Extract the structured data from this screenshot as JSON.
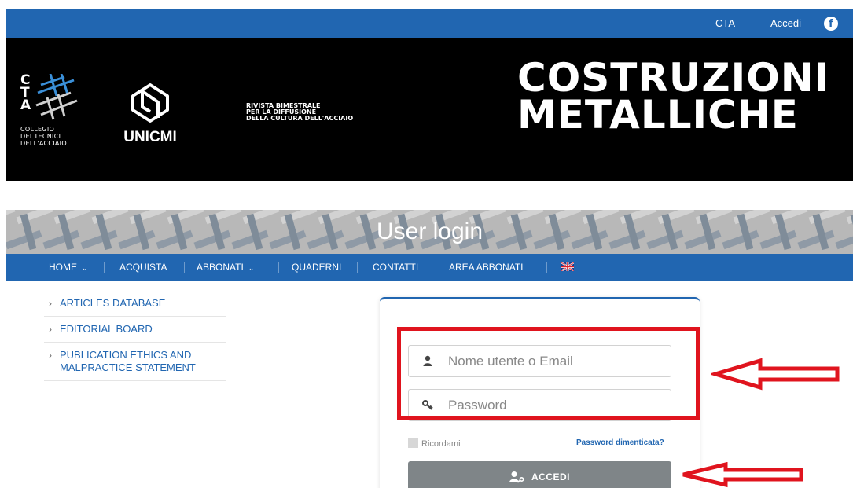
{
  "topbar": {
    "cta_label": "CTA",
    "accedi_label": "Accedi",
    "facebook_icon": "f"
  },
  "header": {
    "cta_logo": {
      "letters": [
        "C",
        "T",
        "A"
      ],
      "small_lines": [
        "COLLEGIO",
        "DEI TECNICI",
        "DELL'ACCIAIO"
      ]
    },
    "unicmi_logo": "UNICMI",
    "tagline": [
      "RIVISTA BIMESTRALE",
      "PER LA DIFFUSIONE",
      "DELLA CULTURA DELL'ACCIAIO"
    ],
    "magazine_title": [
      "COSTRUZIONI",
      "METALLICHE"
    ]
  },
  "banner": {
    "title": "User login"
  },
  "nav": {
    "items": [
      {
        "label": "HOME",
        "has_dropdown": true
      },
      {
        "label": "ACQUISTA",
        "has_dropdown": false
      },
      {
        "label": "ABBONATI",
        "has_dropdown": true
      },
      {
        "label": "QUADERNI",
        "has_dropdown": false
      },
      {
        "label": "CONTATTI",
        "has_dropdown": false
      },
      {
        "label": "AREA ABBONATI",
        "has_dropdown": false
      }
    ],
    "chevron": "⌄",
    "language_flag": "uk-flag-icon"
  },
  "sidebar": {
    "items": [
      {
        "label": "ARTICLES DATABASE"
      },
      {
        "label": "EDITORIAL BOARD"
      },
      {
        "label": "PUBLICATION ETHICS AND MALPRACTICE STATEMENT"
      }
    ],
    "arrow_glyph": "›"
  },
  "login": {
    "username_placeholder": "Nome utente o Email",
    "password_placeholder": "Password",
    "remember_label": "Ricordami",
    "forgot_label": "Password dimenticata?",
    "submit_label": "ACCEDI"
  },
  "colors": {
    "brand_blue": "#2166b1",
    "highlight_red": "#e0141e",
    "button_gray": "#7f8588"
  }
}
